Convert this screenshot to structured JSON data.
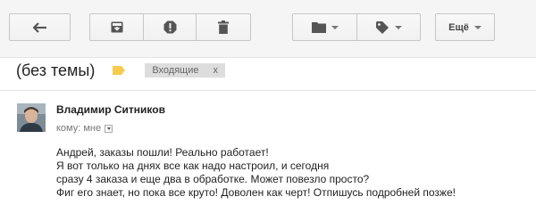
{
  "toolbar": {
    "back_icon": "arrow-back-icon",
    "archive_icon": "archive-icon",
    "spam_icon": "report-spam-icon",
    "delete_icon": "trash-icon",
    "move_icon": "folder-icon",
    "labels_icon": "label-tag-icon",
    "more_label": "Ещё"
  },
  "message": {
    "subject": "(без темы)",
    "importance_color": "#f7cb4d",
    "label": "Входящие",
    "label_remove": "x",
    "sender": "Владимир Ситников",
    "recipients": "кому: мне",
    "body_lines": [
      "Андрей, заказы пошли! Реально работает!",
      "Я вот только на днях все как надо настроил, и сегодня",
      "сразу 4 заказа и еще два в обработке. Может повезло просто?",
      "Фиг его знает, но пока все круто! Доволен как черт! Отпишусь подробней позже!"
    ]
  }
}
